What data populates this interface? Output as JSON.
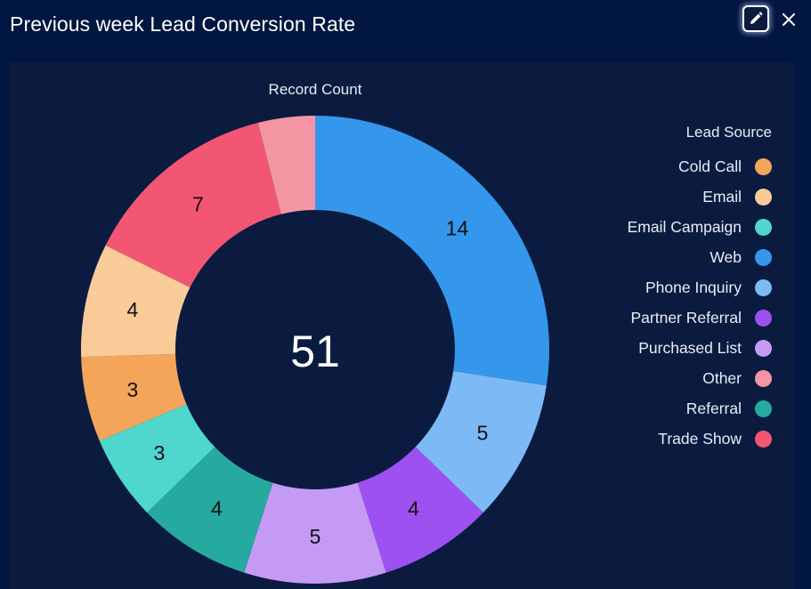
{
  "header": {
    "title": "Previous week Lead Conversion Rate",
    "edit_label": "edit-icon",
    "close_label": "close-icon"
  },
  "legend": {
    "title": "Lead Source",
    "items": [
      {
        "label": "Cold Call",
        "color": "#f5a55a"
      },
      {
        "label": "Email",
        "color": "#f8cb99"
      },
      {
        "label": "Email Campaign",
        "color": "#4fd6cd"
      },
      {
        "label": "Web",
        "color": "#3597ec"
      },
      {
        "label": "Phone Inquiry",
        "color": "#7db9f4"
      },
      {
        "label": "Partner Referral",
        "color": "#9d51f1"
      },
      {
        "label": "Purchased List",
        "color": "#c59af4"
      },
      {
        "label": "Other",
        "color": "#f495a3"
      },
      {
        "label": "Referral",
        "color": "#26aaa0"
      },
      {
        "label": "Trade Show",
        "color": "#f25672"
      }
    ]
  },
  "chart_data": {
    "type": "pie",
    "variant": "donut",
    "title": "Record Count",
    "center_label": "51",
    "total": 51,
    "start": "top",
    "direction": "clockwise",
    "slices": [
      {
        "label": "Web",
        "value": 14,
        "color": "#3597ec",
        "show_label": true
      },
      {
        "label": "Phone Inquiry",
        "value": 5,
        "color": "#7db9f4",
        "show_label": true
      },
      {
        "label": "Partner Referral",
        "value": 4,
        "color": "#9d51f1",
        "show_label": true
      },
      {
        "label": "Purchased List",
        "value": 5,
        "color": "#c59af4",
        "show_label": true
      },
      {
        "label": "Referral",
        "value": 4,
        "color": "#26aaa0",
        "show_label": true
      },
      {
        "label": "Email Campaign",
        "value": 3,
        "color": "#4fd6cd",
        "show_label": true
      },
      {
        "label": "Cold Call",
        "value": 3,
        "color": "#f5a55a",
        "show_label": true
      },
      {
        "label": "Email",
        "value": 4,
        "color": "#f8cb99",
        "show_label": true
      },
      {
        "label": "Trade Show",
        "value": 7,
        "color": "#f25672",
        "show_label": true
      },
      {
        "label": "Other",
        "value": 2,
        "color": "#f495a3",
        "show_label": false
      }
    ],
    "legend_title": "Lead Source",
    "legend_position": "right"
  }
}
